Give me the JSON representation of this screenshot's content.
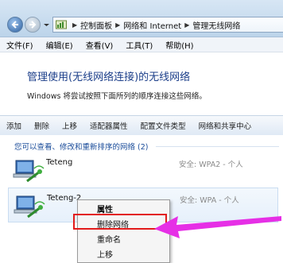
{
  "addressbar": {
    "segments": [
      "控制面板",
      "网络和 Internet",
      "管理无线网络"
    ]
  },
  "menu": [
    "文件(F)",
    "编辑(E)",
    "查看(V)",
    "工具(T)",
    "帮助(H)"
  ],
  "header": {
    "title": "管理使用(无线网络连接)的无线网络",
    "description": "Windows 将尝试按照下面所列的顺序连接这些网络。"
  },
  "toolbar": [
    "添加",
    "删除",
    "上移",
    "适配器属性",
    "配置文件类型",
    "网络和共享中心"
  ],
  "networks": {
    "group_label": "您可以查看、修改和重新排序的网络 (2)",
    "items": [
      {
        "name": "Teteng",
        "security": "安全: WPA2 - 个人"
      },
      {
        "name": "Teteng-2",
        "security": "安全: WPA - 个人"
      }
    ]
  },
  "context_menu": [
    "属性",
    "删除网络",
    "重命名",
    "上移"
  ],
  "colors": {
    "highlight_box": "#e21b1b",
    "annotation_arrow": "#e62fe6",
    "title_blue": "#1c3f8a"
  }
}
